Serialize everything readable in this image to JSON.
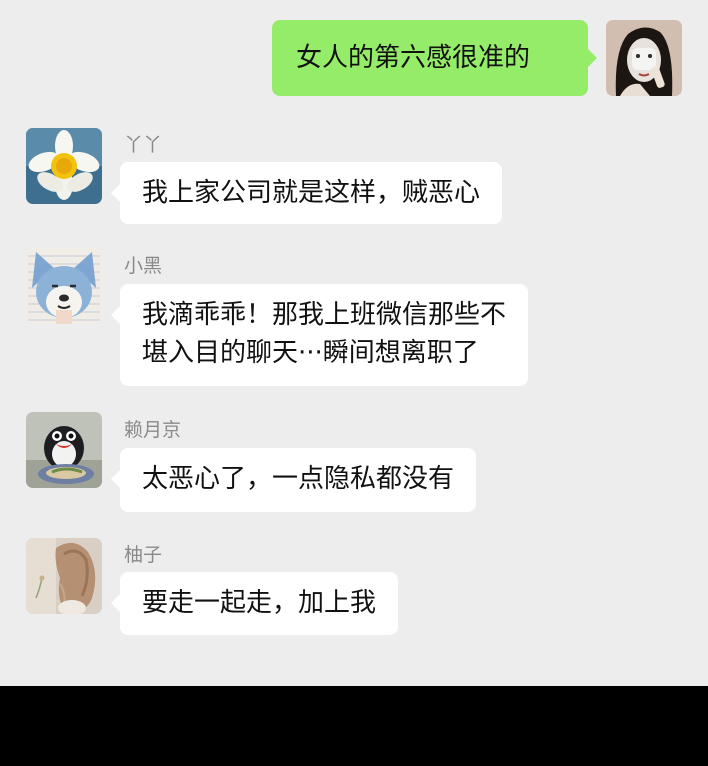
{
  "messages": [
    {
      "side": "right",
      "sender": "",
      "avatar": "woman-face-mask-avatar",
      "lines": [
        "女人的第六感很准的"
      ]
    },
    {
      "side": "left",
      "sender": "丫丫",
      "avatar": "daffodil-flower-avatar",
      "lines": [
        "我上家公司就是这样，贼恶心"
      ]
    },
    {
      "side": "left",
      "sender": "小黑",
      "avatar": "cartoon-dog-avatar",
      "lines": [
        "我滴乖乖！那我上班微信那些不",
        "堪入目的聊天···瞬间想离职了"
      ]
    },
    {
      "side": "left",
      "sender": "赖月京",
      "avatar": "penguin-avatar",
      "lines": [
        "太恶心了，一点隐私都没有"
      ]
    },
    {
      "side": "left",
      "sender": "柚子",
      "avatar": "woman-back-avatar",
      "lines": [
        "要走一起走，加上我"
      ]
    }
  ],
  "colors": {
    "background": "#ededed",
    "self_bubble": "#95ec69",
    "other_bubble": "#ffffff",
    "sender_name": "#8a8a8a",
    "bottom_bar": "#000000"
  }
}
